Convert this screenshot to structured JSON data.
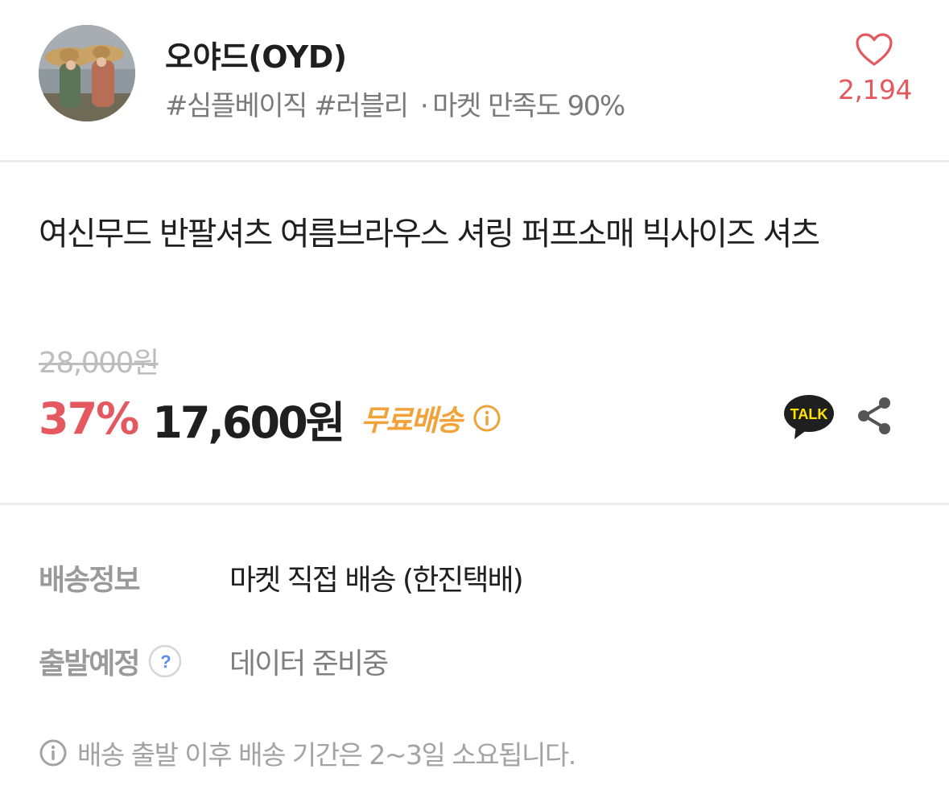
{
  "shop": {
    "name": "오야드(OYD)",
    "tag1": "#심플베이직",
    "tag2": "#러블리",
    "separator": "·",
    "satisfaction": "마켓 만족도 90%",
    "like_count": "2,194"
  },
  "product": {
    "title": "여신무드 반팔셔츠 여름브라우스 셔링 퍼프소매 빅사이즈 셔츠",
    "original_price": "28,000원",
    "discount": "37%",
    "sale_price": "17,600원",
    "free_shipping": "무료배송",
    "talk_label": "TALK"
  },
  "shipping": {
    "info_label": "배송정보",
    "info_value": "마켓 직접 배송 (한진택배)",
    "depart_label": "출발예정",
    "depart_help": "?",
    "depart_value": "데이터 준비중",
    "note": "배송 출발 이후 배송 기간은 2~3일 소요됩니다."
  },
  "colors": {
    "accent_red": "#e4595f",
    "accent_orange": "#f1a33a",
    "kakao_yellow": "#fee500",
    "help_blue": "#5b8def"
  },
  "icons": {
    "avatar": "shop-profile-photo",
    "like": "heart-icon",
    "free_shipping_info": "info-icon",
    "talk": "kakao-talk-icon",
    "share": "share-icon",
    "help": "question-icon",
    "note": "info-icon"
  }
}
